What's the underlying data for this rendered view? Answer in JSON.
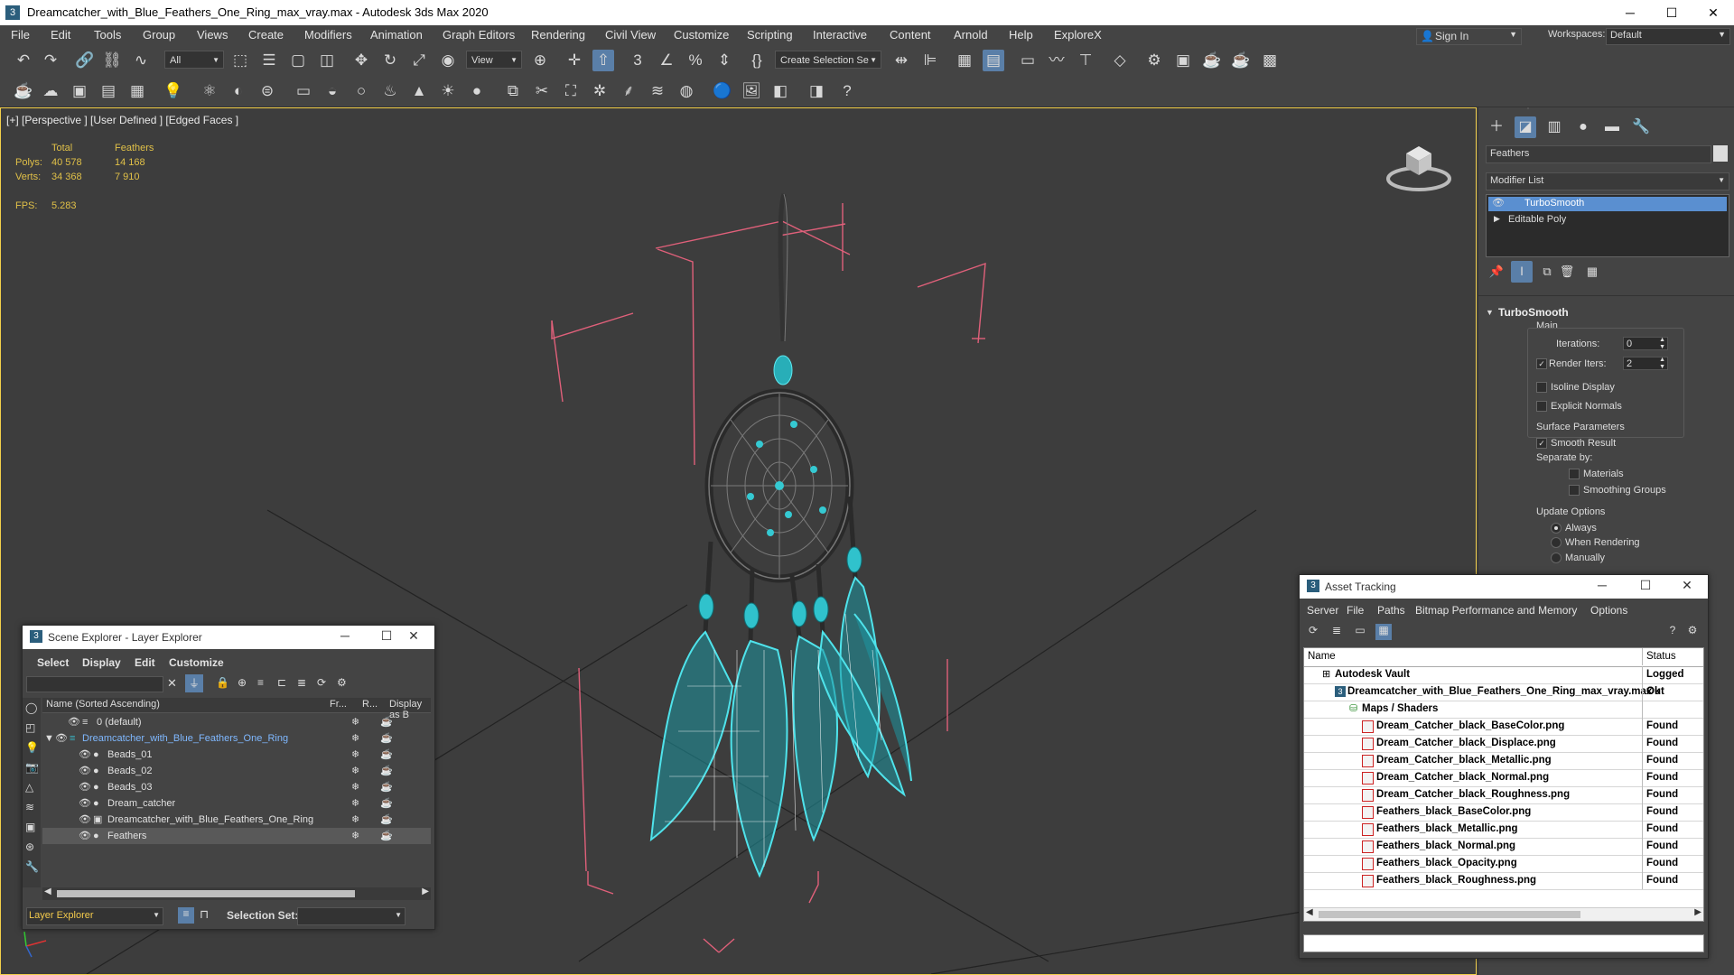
{
  "window": {
    "title": "Dreamcatcher_with_Blue_Feathers_One_Ring_max_vray.max - Autodesk 3ds Max 2020",
    "app_icon": "3",
    "minimize": "─",
    "maximize": "☐",
    "close": "✕"
  },
  "menu": [
    "File",
    "Edit",
    "Tools",
    "Group",
    "Views",
    "Create",
    "Modifiers",
    "Animation",
    "Graph Editors",
    "Rendering",
    "Civil View",
    "Customize",
    "Scripting",
    "Interactive",
    "Content",
    "Arnold",
    "Help",
    "ExploreX"
  ],
  "account": {
    "sign_in": "Sign In",
    "workspaces_label": "Workspaces:",
    "workspace": "Default"
  },
  "toolbar": {
    "selection_filter": "All",
    "ref_coord": "View",
    "create_selection_set": "Create Selection Se",
    "toolbar_size_hint": "3"
  },
  "viewport": {
    "label": "[+] [Perspective ] [User Defined ] [Edged Faces ]",
    "stats": {
      "col_total": "Total",
      "col_feathers": "Feathers",
      "polys_label": "Polys:",
      "polys_total": "40 578",
      "polys_feathers": "14 168",
      "verts_label": "Verts:",
      "verts_total": "34 368",
      "verts_feathers": "7 910",
      "fps_label": "FPS:",
      "fps_value": "5.283"
    },
    "colors": {
      "wire_cyan": "#3fd8e0",
      "bbox_pink": "#e0607a",
      "grid": "#1e1e1e"
    }
  },
  "command_panel": {
    "object_name": "Feathers",
    "modifier_list": "Modifier List",
    "stack": [
      "TurboSmooth",
      "Editable Poly"
    ],
    "rollout_title": "TurboSmooth",
    "main_label": "Main",
    "iterations_label": "Iterations:",
    "iterations_value": "0",
    "render_iters_label": "Render Iters:",
    "render_iters_value": "2",
    "isoline_display": "Isoline Display",
    "explicit_normals": "Explicit Normals",
    "surface_params": "Surface Parameters",
    "smooth_result": "Smooth Result",
    "separate_by": "Separate by:",
    "materials": "Materials",
    "smoothing_groups": "Smoothing Groups",
    "update_options": "Update Options",
    "always": "Always",
    "when_rendering": "When Rendering",
    "manually": "Manually"
  },
  "scene_explorer": {
    "title": "Scene Explorer - Layer Explorer",
    "menu": [
      "Select",
      "Display",
      "Edit",
      "Customize"
    ],
    "col_name": "Name (Sorted Ascending)",
    "col_frozen": "Fr...",
    "col_render": "R...",
    "col_display": "Display as B",
    "rows": [
      {
        "label": "0 (default)"
      },
      {
        "label": "Dreamcatcher_with_Blue_Feathers_One_Ring"
      },
      {
        "label": "Beads_01"
      },
      {
        "label": "Beads_02"
      },
      {
        "label": "Beads_03"
      },
      {
        "label": "Dream_catcher"
      },
      {
        "label": "Dreamcatcher_with_Blue_Feathers_One_Ring"
      },
      {
        "label": "Feathers"
      }
    ],
    "footer_mode": "Layer Explorer",
    "selection_set_label": "Selection Set:"
  },
  "asset_tracking": {
    "title": "Asset Tracking",
    "menu": [
      "Server",
      "File",
      "Paths",
      "Bitmap Performance and Memory",
      "Options"
    ],
    "col_name": "Name",
    "col_status": "Status",
    "rows": [
      {
        "name": "Autodesk Vault",
        "status": "Logged Out"
      },
      {
        "name": "Dreamcatcher_with_Blue_Feathers_One_Ring_max_vray.max",
        "status": "Ok"
      },
      {
        "name": "Maps / Shaders",
        "status": ""
      },
      {
        "name": "Dream_Catcher_black_BaseColor.png",
        "status": "Found"
      },
      {
        "name": "Dream_Catcher_black_Displace.png",
        "status": "Found"
      },
      {
        "name": "Dream_Catcher_black_Metallic.png",
        "status": "Found"
      },
      {
        "name": "Dream_Catcher_black_Normal.png",
        "status": "Found"
      },
      {
        "name": "Dream_Catcher_black_Roughness.png",
        "status": "Found"
      },
      {
        "name": "Feathers_black_BaseColor.png",
        "status": "Found"
      },
      {
        "name": "Feathers_black_Metallic.png",
        "status": "Found"
      },
      {
        "name": "Feathers_black_Normal.png",
        "status": "Found"
      },
      {
        "name": "Feathers_black_Opacity.png",
        "status": "Found"
      },
      {
        "name": "Feathers_black_Roughness.png",
        "status": "Found"
      }
    ]
  }
}
